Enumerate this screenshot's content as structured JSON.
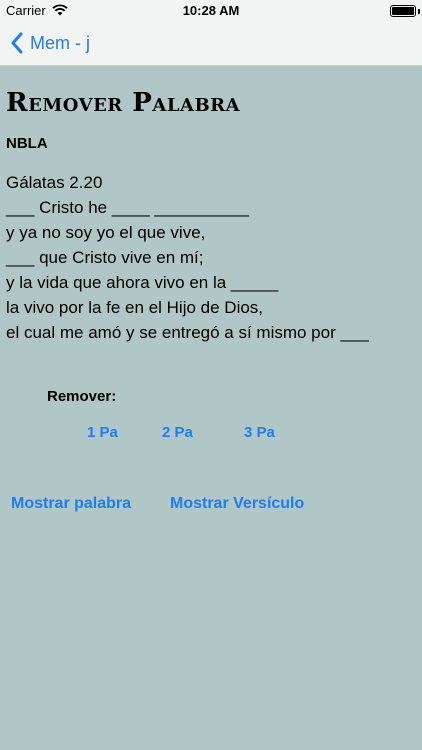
{
  "status_bar": {
    "carrier": "Carrier",
    "time": "10:28 AM",
    "battery_level": 1.0
  },
  "nav": {
    "back_label": "Mem - j"
  },
  "page": {
    "title": "Remover Palabra",
    "version": "NBLA"
  },
  "verse": {
    "reference": "Gálatas 2.20",
    "lines": [
      "___ Cristo he ____ __________",
      "y ya no soy yo el que vive,",
      "___ que Cristo vive en mí;",
      "y la vida que ahora vivo en la _____",
      "la vivo por la fe en el Hijo de Dios,",
      "el cual me amó y se entregó a sí mismo por ___"
    ]
  },
  "remove": {
    "label": "Remover:",
    "options": [
      "1 Pa",
      "2 Pa",
      "3 Pa"
    ]
  },
  "actions": {
    "show_word": "Mostrar palabra",
    "show_verse": "Mostrar Versículo"
  },
  "colors": {
    "background": "#b1c6c7",
    "accent": "#1e7ef0",
    "bar": "#f2f3f3"
  }
}
